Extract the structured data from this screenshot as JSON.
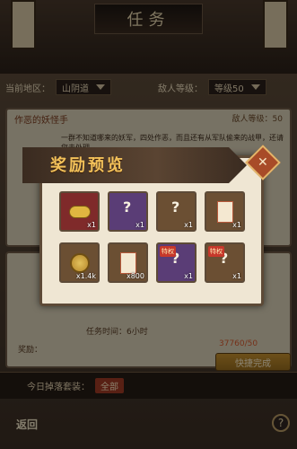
{
  "header": {
    "title": "任务"
  },
  "filters": {
    "region_label": "当前地区：",
    "region_value": "山阴道",
    "enemy_level_label": "敌人等级：",
    "enemy_level_value": "等级50"
  },
  "quest": {
    "title": "作恶的妖怪手",
    "enemy_level_label": "敌人等级：",
    "enemy_level_value": "50",
    "description": "一群不知道哪来的妖军，四处作恶，而且还有从军队偷来的战甲，还请您去处理。",
    "time_label": "任务时间：",
    "time_value": "6小时",
    "reward_label": "奖励："
  },
  "rewards_modal": {
    "title": "奖励预览",
    "items": [
      {
        "icon": "gold-nuggets-icon",
        "count": "x1",
        "tint": "red"
      },
      {
        "icon": "mystery-item-icon",
        "count": "x1",
        "tint": "purple"
      },
      {
        "icon": "mystery-item-icon",
        "count": "x1",
        "tint": "brown"
      },
      {
        "icon": "talisman-icon",
        "count": "x1",
        "tint": "brown"
      },
      {
        "icon": "coin-icon",
        "count": "x1.4k",
        "tint": "brown"
      },
      {
        "icon": "scroll-tag-icon",
        "count": "x800",
        "tint": "brown"
      },
      {
        "icon": "mystery-item-icon",
        "count": "x1",
        "tint": "purple",
        "tag": "特权"
      },
      {
        "icon": "mystery-item-icon",
        "count": "x1",
        "tint": "brown",
        "tag": "特权"
      }
    ]
  },
  "footer": {
    "drop_label": "今日掉落套装：",
    "drop_value": "全部",
    "cost_value": "37760/50",
    "quick_finish_label": "快捷完成",
    "back_label": "返回",
    "help_label": "?"
  }
}
